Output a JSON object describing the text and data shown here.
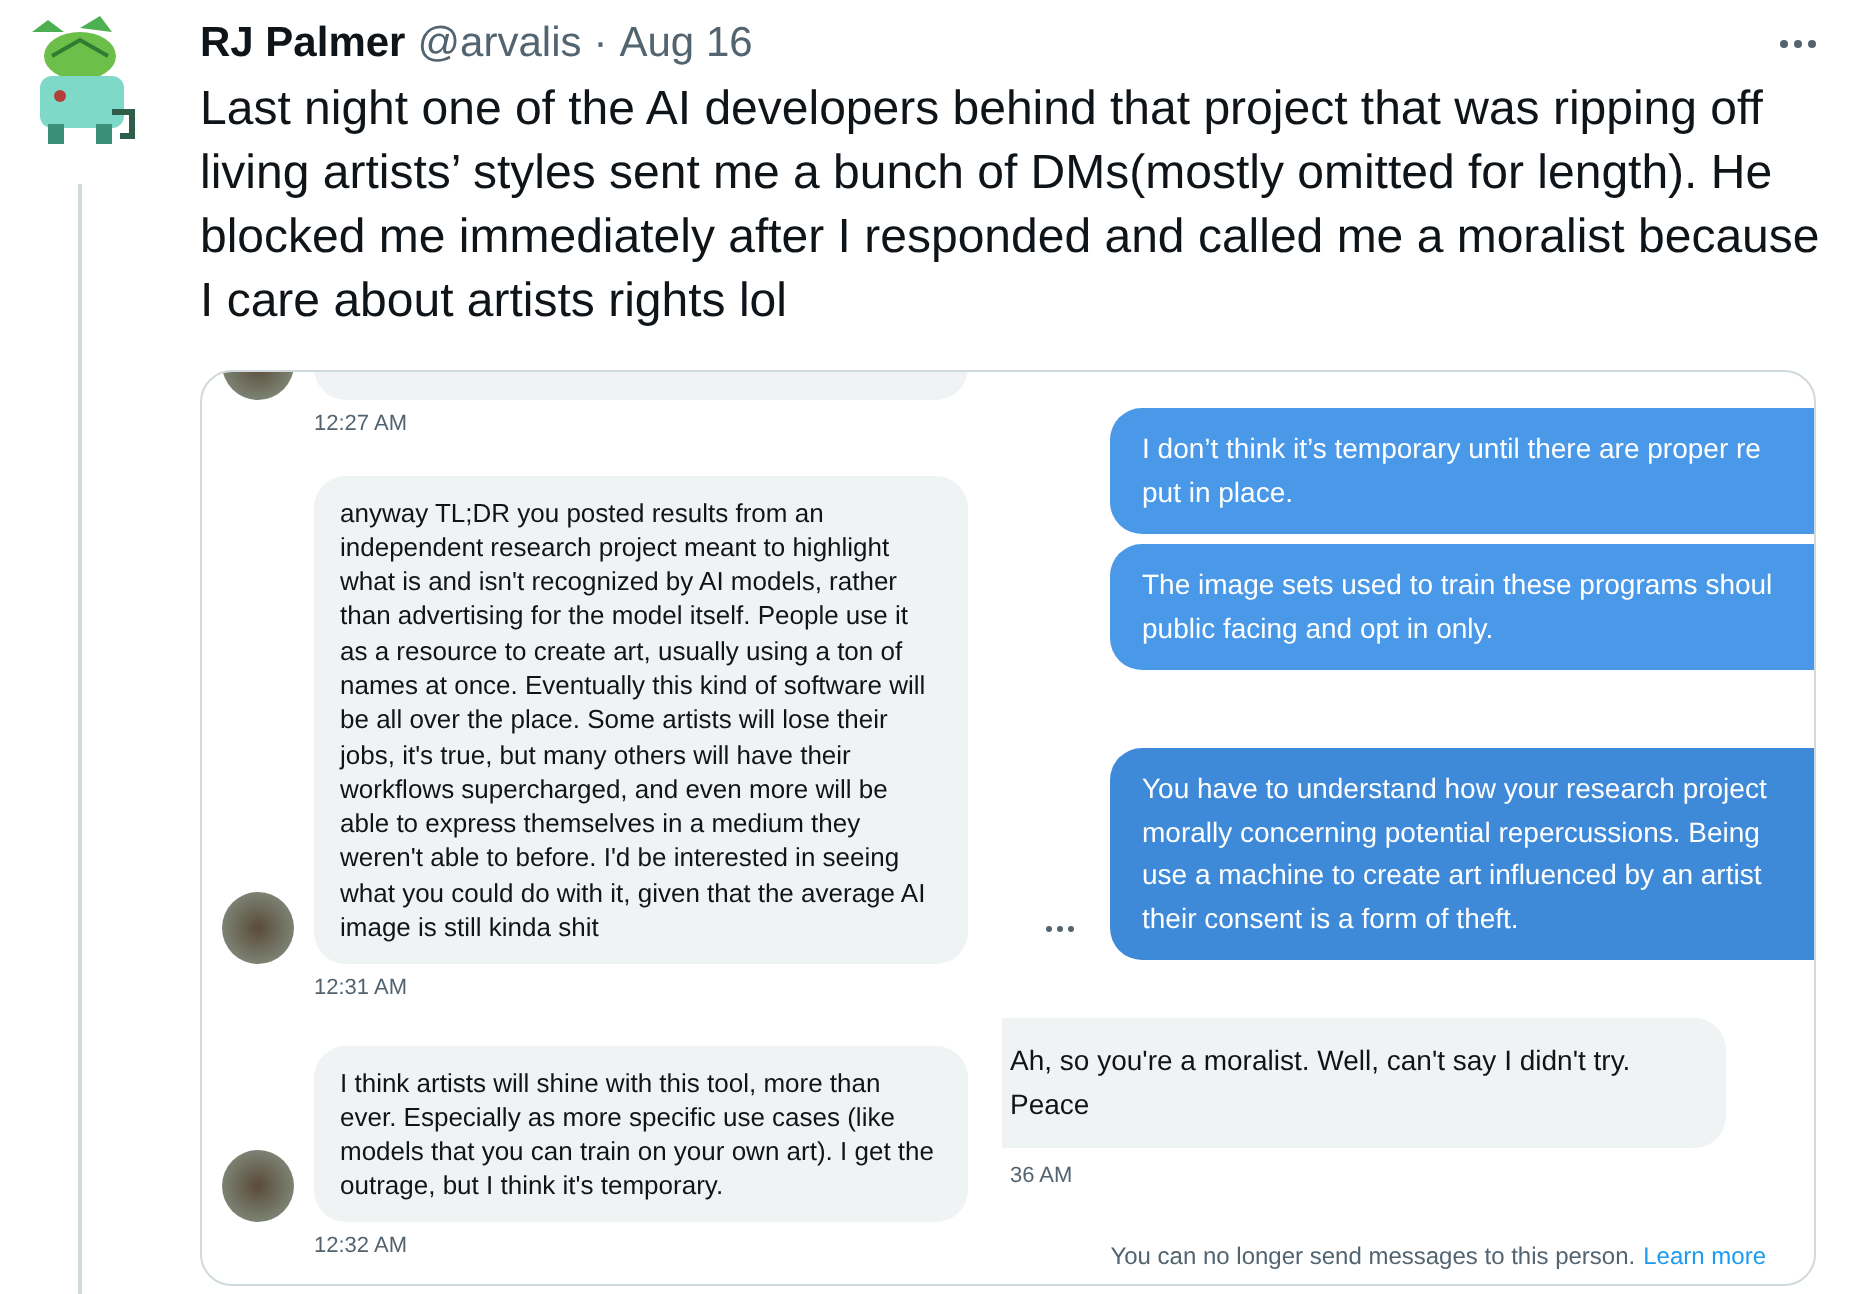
{
  "tweet": {
    "name": "RJ Palmer",
    "handle": "@arvalis",
    "separator": "·",
    "date": "Aug 16",
    "text": "Last night one of the AI developers behind that project that was ripping off living artists’ styles sent me a bunch of DMs(mostly omitted for length). He blocked me immediately after I responded and called me a moralist because I care about artists rights lol"
  },
  "dm_screenshot": {
    "left_messages": [
      {
        "kind": "clipped",
        "time": "12:27 AM"
      },
      {
        "kind": "message",
        "text": "anyway TL;DR you posted results from an independent research project meant to highlight what is and isn't recognized by AI models, rather than advertising for the model itself. People use it as a resource to create art, usually using a ton of names at once. Eventually this kind of software will be all over the place. Some artists will lose their jobs, it's true, but many others will have their workflows supercharged, and even more will be able to express themselves in a medium they weren't able to before. I'd be interested in seeing what you could do with it, given that the average AI image is still kinda shit",
        "time": "12:31 AM"
      },
      {
        "kind": "message",
        "text": "I think artists will shine with this tool, more than ever. Especially as more specific use cases (like models that you can train on your own art). I get the outrage, but I think it's temporary.",
        "time": "12:32 AM"
      }
    ],
    "right_messages": [
      {
        "kind": "sent",
        "hovered": false,
        "text": "I don’t think it’s temporary until there are proper re\nput in place."
      },
      {
        "kind": "sent",
        "hovered": false,
        "text": "The image sets used to train these programs shoul\npublic facing and opt in only."
      },
      {
        "kind": "sent",
        "hovered": true,
        "text": "You have to understand how your research project\nmorally concerning potential repercussions. Being\nuse a machine to create art influenced by an artist\ntheir consent is a form of theft."
      },
      {
        "kind": "received",
        "text": "Ah, so you're a moralist. Well, can't say I didn't try.\nPeace",
        "time": "36 AM"
      }
    ],
    "notice": {
      "text": "You can no longer send messages to this person.",
      "link": "Learn more"
    }
  }
}
